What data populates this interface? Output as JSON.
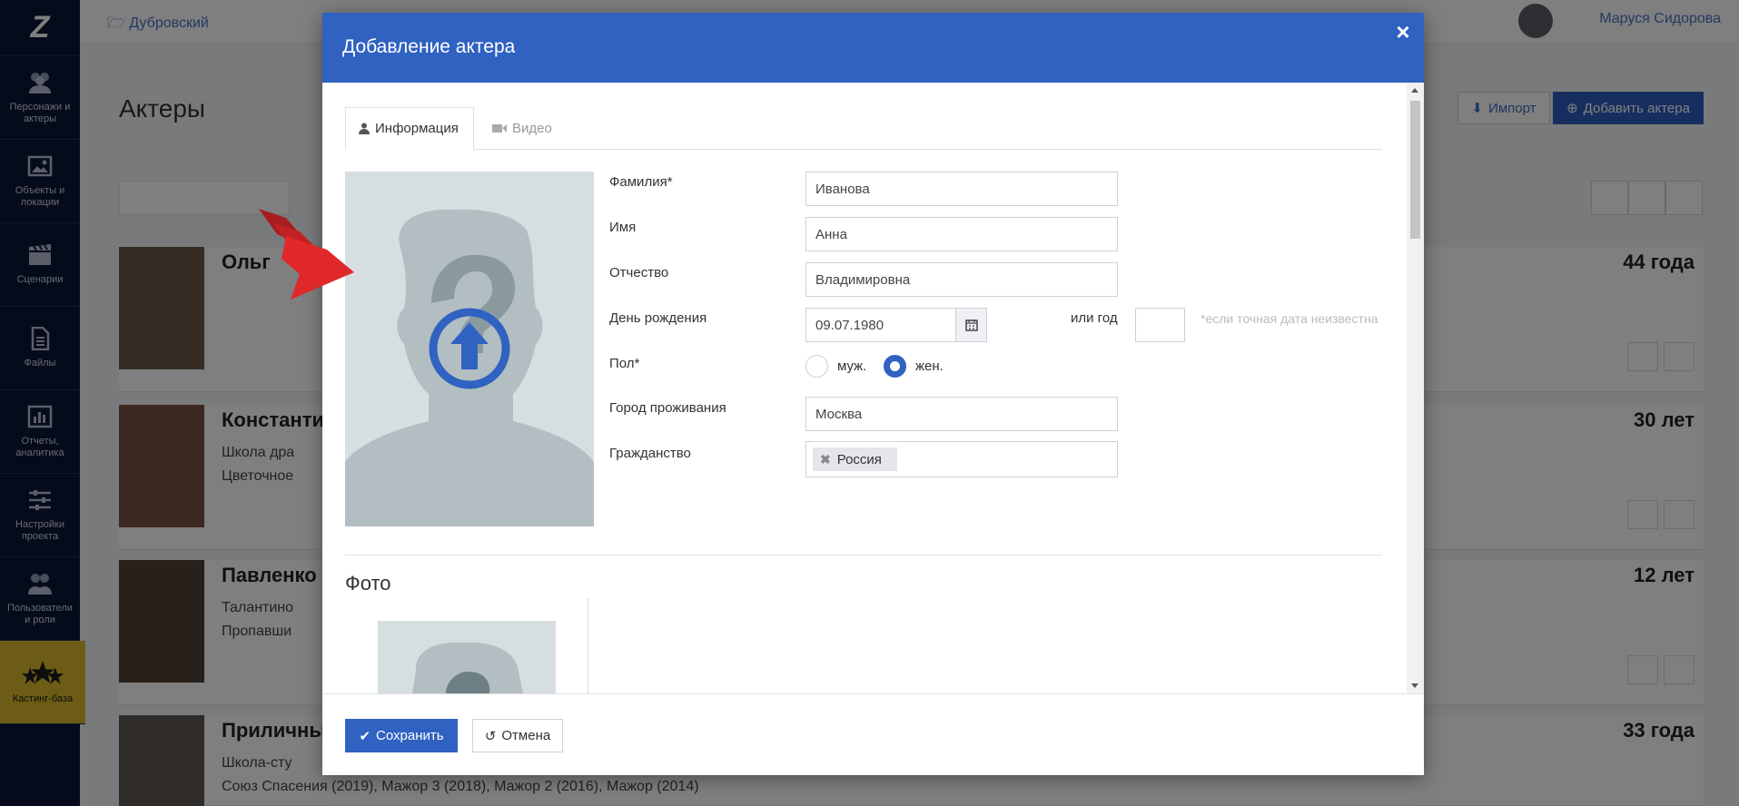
{
  "sidebar": {
    "logo": "Z",
    "items": [
      {
        "label": "Персонажи и актеры",
        "icon": "people-icon"
      },
      {
        "label": "Объекты и локации",
        "icon": "image-icon"
      },
      {
        "label": "Сценарии",
        "icon": "clapperboard-icon"
      },
      {
        "label": "Файлы",
        "icon": "file-icon"
      },
      {
        "label": "Отчеты, аналитика",
        "icon": "chart-icon"
      },
      {
        "label": "Настройки проекта",
        "icon": "sliders-icon"
      },
      {
        "label": "Пользователи и роли",
        "icon": "users-icon"
      },
      {
        "label": "Кастинг-база",
        "icon": "stars-icon"
      }
    ]
  },
  "topbar": {
    "project": "Дубровский",
    "user": "Маруся Сидорова"
  },
  "page": {
    "title": "Актеры",
    "import_label": "Импорт",
    "add_label": "Добавить актера",
    "actors": [
      {
        "name": "Ольг",
        "age": "44 года",
        "line1": "",
        "line2": ""
      },
      {
        "name": "Константи",
        "age": "30 лет",
        "line1": "Школа дра",
        "line2": "Цветочное"
      },
      {
        "name": "Павленко",
        "age": "12 лет",
        "line1": "Талантино",
        "line2": "Пропавши"
      },
      {
        "name": "Приличны",
        "age": "33 года",
        "line1": "Школа-сту",
        "line2": "Союз Спасения (2019), Мажор 3 (2018), Мажор 2 (2016), Мажор (2014)"
      }
    ]
  },
  "modal": {
    "title": "Добавление актера",
    "close": "×",
    "tabs": [
      {
        "label": "Информация"
      },
      {
        "label": "Видео"
      }
    ],
    "form": {
      "lastname_label": "Фамилия*",
      "lastname_value": "Иванова",
      "firstname_label": "Имя",
      "firstname_value": "Анна",
      "patronymic_label": "Отчество",
      "patronymic_value": "Владимировна",
      "birthday_label": "День рождения",
      "birthday_value": "09.07.1980",
      "or_year_label": "или год",
      "year_hint": "*если точная дата неизвестна",
      "gender_label": "Пол*",
      "gender_male": "муж.",
      "gender_female": "жен.",
      "gender_selected": "жен.",
      "city_label": "Город проживания",
      "city_value": "Москва",
      "citizenship_label": "Гражданство",
      "citizenship_tag": "Россия"
    },
    "photo_section_title": "Фото",
    "save_label": "Сохранить",
    "cancel_label": "Отмена"
  },
  "colors": {
    "accent": "#2f62c1",
    "sidebar_bg": "#0b1634",
    "active_item": "#d9b92a",
    "arrow_red": "#e0282b"
  }
}
